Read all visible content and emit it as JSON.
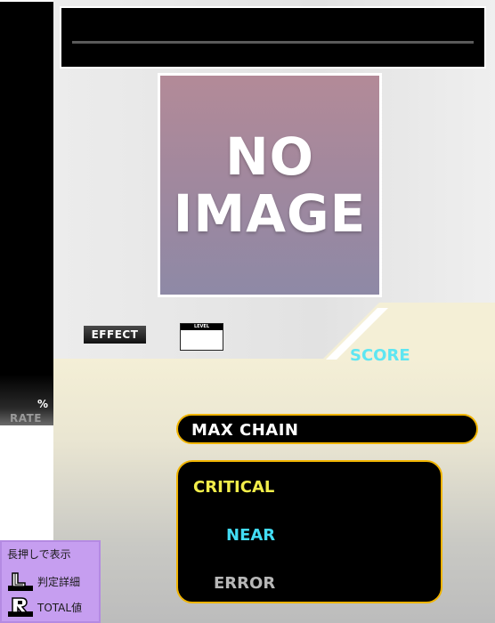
{
  "rate": {
    "unit": "%",
    "label": "RATE"
  },
  "jacket": {
    "line1": "NO",
    "line2": "IMAGE"
  },
  "effect": {
    "label": "EFFECT"
  },
  "level": {
    "header": "LEVEL"
  },
  "score": {
    "label": "SCORE"
  },
  "max_chain": {
    "label": "MAX CHAIN"
  },
  "judgements": {
    "critical": "CRITICAL",
    "near": "NEAR",
    "error": "ERROR"
  },
  "help": {
    "title": "長押しで表示",
    "items": [
      {
        "key": "L",
        "label": "判定詳細"
      },
      {
        "key": "R",
        "label": "TOTAL値"
      }
    ]
  },
  "colors": {
    "score_cyan": "#5ee6f2",
    "critical_yellow": "#f2ee4a",
    "near_cyan": "#42dcf4",
    "error_gray": "#b7b7b7",
    "frame_gold": "#f0b400",
    "help_purple": "#c69ef0"
  }
}
